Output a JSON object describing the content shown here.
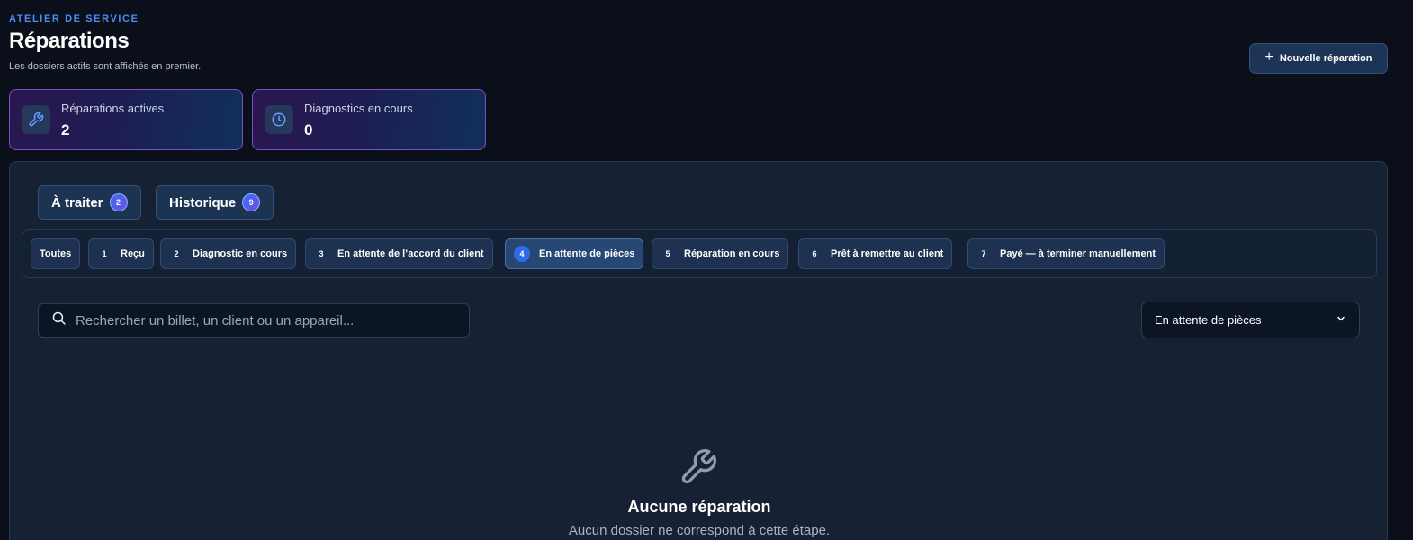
{
  "header": {
    "eyebrow": "ATELIER DE SERVICE",
    "title": "Réparations",
    "subtitle": "Les dossiers actifs sont affichés en premier.",
    "new_button_label": "Nouvelle réparation",
    "new_button_icon": "plus-icon"
  },
  "stats": [
    {
      "label": "Réparations actives",
      "value": "2",
      "icon": "wrench-icon"
    },
    {
      "label": "Diagnostics en cours",
      "value": "0",
      "icon": "clock-icon"
    }
  ],
  "tabs": [
    {
      "label": "À traiter",
      "count": "2"
    },
    {
      "label": "Historique",
      "count": "9"
    }
  ],
  "steps": [
    {
      "num": "",
      "label": "Toutes"
    },
    {
      "num": "1",
      "label": "Reçu"
    },
    {
      "num": "2",
      "label": "Diagnostic en cours"
    },
    {
      "num": "3",
      "label": "En attente de l’accord du client"
    },
    {
      "num": "4",
      "label": "En attente de pièces",
      "active": true
    },
    {
      "num": "5",
      "label": "Réparation en cours"
    },
    {
      "num": "6",
      "label": "Prêt à remettre au client"
    },
    {
      "num": "7",
      "label": "Payé — à terminer manuellement"
    }
  ],
  "search": {
    "placeholder": "Rechercher un billet, un client ou un appareil..."
  },
  "filter": {
    "selected": "En attente de pièces"
  },
  "empty": {
    "icon": "wrench-icon",
    "title": "Aucune réparation",
    "subtitle": "Aucun dossier ne correspond à cette étape."
  },
  "colors": {
    "background": "#0a0f1a",
    "panel": "#162234",
    "accent": "#4b8df5",
    "card_border": "#7b4fc4"
  }
}
